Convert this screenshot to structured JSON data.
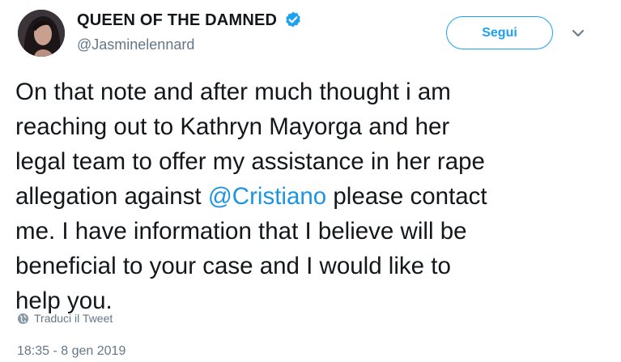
{
  "author": {
    "display_name": "QUEEN OF THE DAMNED",
    "handle": "@Jasminelennard",
    "verified": true
  },
  "actions": {
    "follow_label": "Segui"
  },
  "tweet": {
    "lines": [
      {
        "text": "On that note and after much thought i am"
      },
      {
        "text": "reaching out to Kathryn Mayorga and her"
      },
      {
        "text": "legal team to offer my assistance in her rape"
      },
      {
        "before": "allegation against ",
        "mention": "@Cristiano",
        "after": " please contact"
      },
      {
        "text": "me. I have information that I believe will be"
      },
      {
        "text": "beneficial to your case and I would like to"
      },
      {
        "text": "help you."
      }
    ]
  },
  "translate": {
    "label": "Traduci il Tweet",
    "icon": "globe-icon"
  },
  "meta": {
    "timestamp": "18:35 - 8 gen 2019"
  },
  "colors": {
    "accent": "#1da1f2",
    "mention": "#1b95e0",
    "muted": "#657786",
    "text": "#14171a"
  }
}
